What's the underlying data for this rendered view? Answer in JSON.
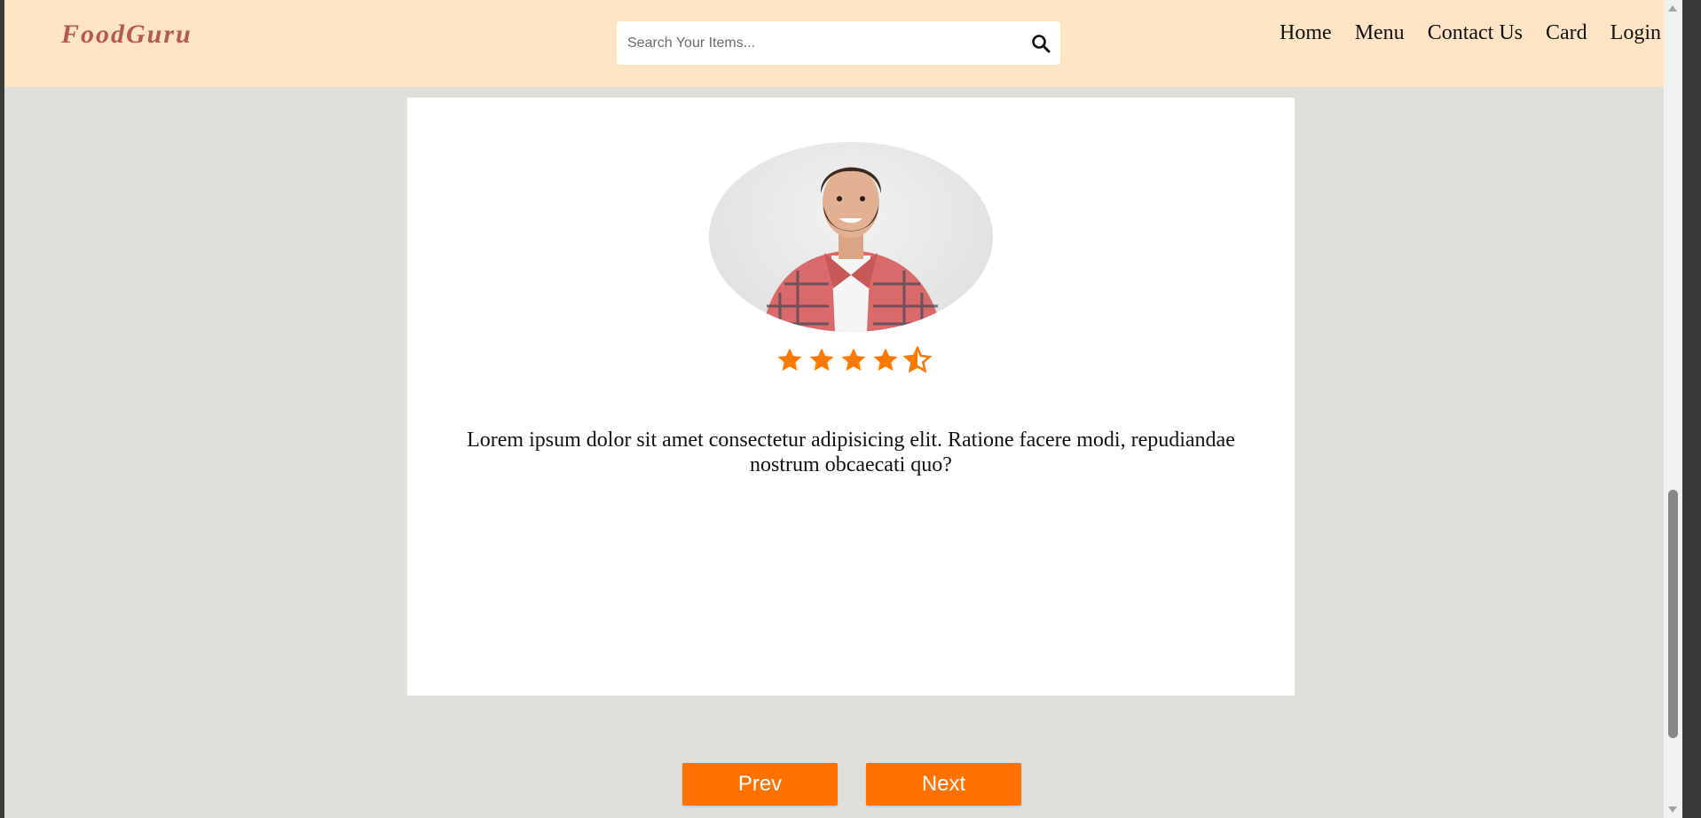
{
  "navbar": {
    "logo": "FoodGuru",
    "search": {
      "placeholder": "Search Your Items...",
      "value": ""
    },
    "links": [
      "Home",
      "Menu",
      "Contact Us",
      "Card",
      "Login"
    ]
  },
  "testimonial": {
    "rating": 4.5,
    "rating_max": 5,
    "star_color": "#ff7b00",
    "text": "Lorem ipsum dolor sit amet consectetur adipisicing elit. Ratione facere modi, repudiandae nostrum obcaecati quo?"
  },
  "buttons": {
    "prev": "Prev",
    "next": "Next"
  },
  "colors": {
    "nav_bg": "#fee4c4",
    "logo": "#b55a52",
    "page_bg": "#e0dfdc",
    "button": "#ff7200"
  }
}
